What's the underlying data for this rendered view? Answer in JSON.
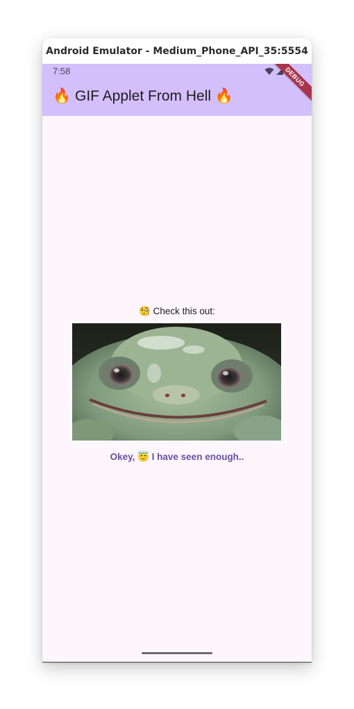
{
  "window": {
    "title": "Android Emulator - Medium_Phone_API_35:5554"
  },
  "status_bar": {
    "time": "7:58",
    "icons": [
      "wifi-icon",
      "cell-signal-icon",
      "battery-icon"
    ]
  },
  "debug_banner": {
    "label": "DEBUG"
  },
  "app_bar": {
    "title": "🔥 GIF Applet From Hell 🔥",
    "background_color": "#d3bffc"
  },
  "main": {
    "prompt": "🧐 Check this out:",
    "gif_subject": "frog",
    "button_label": "Okey, 😇 I have seen enough..",
    "accent_color": "#6750a4",
    "background_color": "#fdf6fc"
  }
}
